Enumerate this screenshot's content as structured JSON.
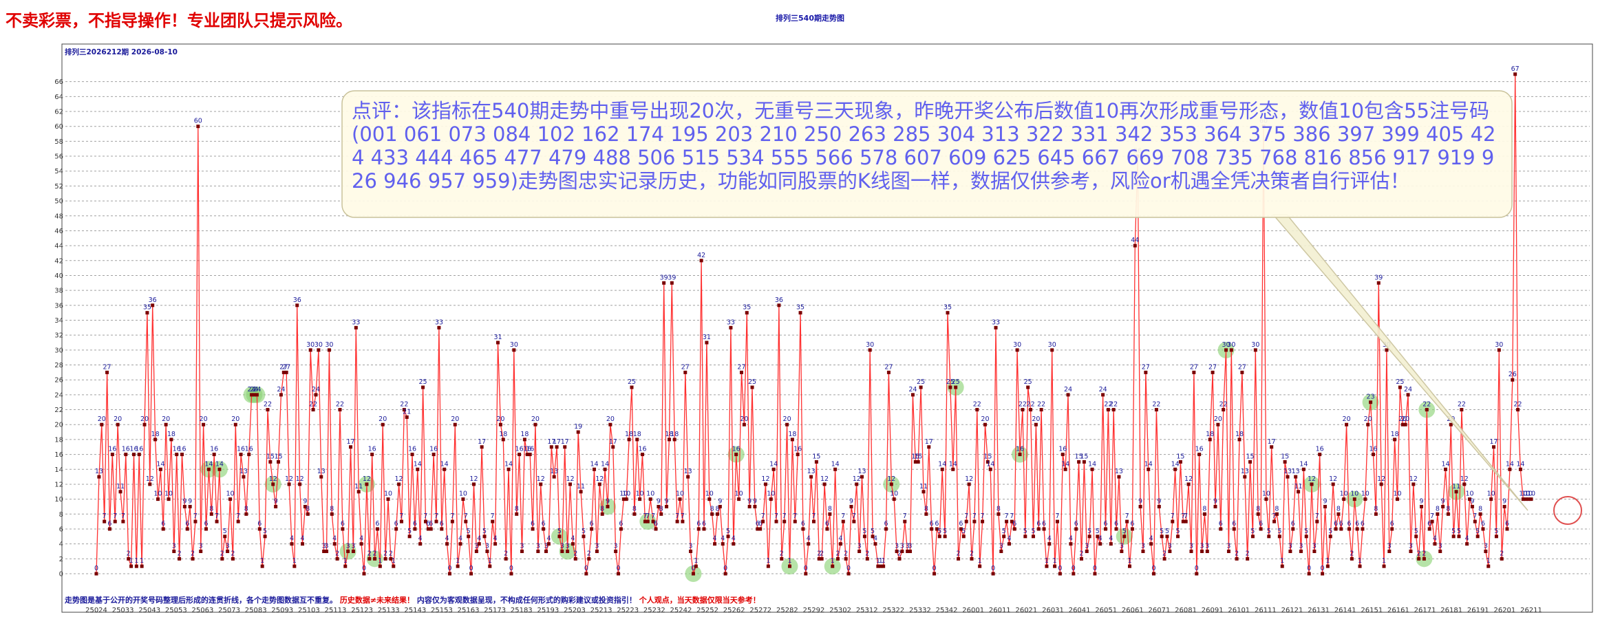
{
  "page": {
    "warning": "不卖彩票，不指导操作！专业团队只提示风险。",
    "title": "排列三540期走势图",
    "issue_label": "排列三2026212期  2026-08-10",
    "footer_blue": "走势图是基于公开的开奖号码整理后形成的连贯折线，各个走势图数据互不重复。",
    "footer_red1": "历史数据≠未来结果！",
    "footer_blue2": "内容仅为客观数据呈现，不构成任何形式的购彩建议或投资指引！",
    "footer_red2": "个人观点，当天数据仅限当天参考！",
    "callout": "点评：该指标在540期走势中重号出现20次，无重号三天现象，昨晚开奖公布后数值10再次形成重号形态，数值10包含55注号码(001 061 073 084 102 162 174 195 203 210 250 263 285 304 313 322 331 342 353 364 375 386 397 399 405 424 433 444 465 477 479 488 506 515 534 555 566 578 607 609 625 645 667 669 708 735 768 816 856 917 919 926 946 957 959)走势图忠实记录历史，功能如同股票的K线图一样，数据仅供参考，风险or机遇全凭决策者自行评估！"
  },
  "colors": {
    "line": "#ff3030",
    "point": "#7a0000",
    "label": "#1a1a9a",
    "grid": "#a0a0a0",
    "highlight": "#8fd47a",
    "callout_bg": "#fffbe6",
    "callout_text": "#6060ee",
    "warning": "#e00000"
  },
  "chart_data": {
    "type": "line",
    "title": "排列三540期走势图",
    "xlabel": "",
    "ylabel": "",
    "ylim": [
      0,
      68
    ],
    "yticks": [
      0,
      2,
      4,
      6,
      8,
      10,
      12,
      14,
      16,
      18,
      20,
      22,
      24,
      26,
      28,
      30,
      32,
      34,
      36,
      38,
      40,
      42,
      44,
      46,
      48,
      50,
      52,
      54,
      56,
      58,
      60,
      62,
      64,
      66
    ],
    "grid": true,
    "x_tick_labels": [
      "25024",
      "25033",
      "25043",
      "25053",
      "25063",
      "25073",
      "25083",
      "25093",
      "25103",
      "25113",
      "25123",
      "25133",
      "25143",
      "25153",
      "25163",
      "25173",
      "25183",
      "25193",
      "25203",
      "25213",
      "25223",
      "25232",
      "25242",
      "25252",
      "25262",
      "25272",
      "25282",
      "25292",
      "25302",
      "25312",
      "25322",
      "25332",
      "25342",
      "26001",
      "26011",
      "26021",
      "26031",
      "26041",
      "26051",
      "26061",
      "26071",
      "26081",
      "26091",
      "26101",
      "26111",
      "26121",
      "26131",
      "26141",
      "26151",
      "26161",
      "26171",
      "26181",
      "26191",
      "26201",
      "26211"
    ],
    "series": [
      {
        "values": [
          0,
          13,
          20,
          7,
          27,
          6,
          16,
          7,
          20,
          11,
          7,
          16,
          2,
          1,
          16,
          1,
          16,
          1,
          20,
          35,
          12,
          36,
          18,
          10,
          14,
          6,
          20,
          10,
          18,
          3,
          16,
          2,
          16,
          9,
          6,
          9,
          2,
          7,
          60,
          3,
          20,
          6,
          14,
          8,
          16,
          7,
          14,
          2,
          5,
          3,
          10,
          2,
          20,
          7,
          16,
          13,
          8,
          16,
          24,
          24,
          24,
          6,
          1,
          5,
          22,
          15,
          12,
          9,
          15,
          24,
          27,
          27,
          12,
          4,
          1,
          36,
          12,
          4,
          9,
          8,
          30,
          22,
          24,
          30,
          13,
          3,
          3,
          30,
          8,
          4,
          2,
          22,
          6,
          1,
          3,
          17,
          3,
          33,
          11,
          4,
          0,
          12,
          2,
          16,
          2,
          6,
          1,
          20,
          2,
          10,
          2,
          1,
          6,
          12,
          7,
          22,
          21,
          5,
          16,
          6,
          14,
          4,
          25,
          7,
          6,
          6,
          16,
          7,
          33,
          6,
          14,
          4,
          0,
          7,
          20,
          1,
          4,
          10,
          7,
          5,
          0,
          12,
          3,
          4,
          17,
          5,
          3,
          1,
          7,
          4,
          31,
          20,
          18,
          2,
          14,
          0,
          30,
          8,
          16,
          3,
          18,
          16,
          16,
          6,
          20,
          3,
          12,
          6,
          3,
          4,
          17,
          13,
          17,
          5,
          3,
          17,
          3,
          12,
          4,
          2,
          19,
          11,
          5,
          0,
          2,
          6,
          14,
          3,
          12,
          8,
          14,
          9,
          20,
          17,
          3,
          0,
          6,
          10,
          10,
          18,
          25,
          8,
          18,
          10,
          16,
          7,
          7,
          10,
          7,
          6,
          9,
          8,
          39,
          9,
          18,
          39,
          18,
          7,
          10,
          7,
          27,
          13,
          3,
          0,
          1,
          6,
          42,
          6,
          31,
          10,
          8,
          4,
          8,
          9,
          4,
          0,
          5,
          33,
          4,
          16,
          10,
          27,
          20,
          35,
          9,
          25,
          9,
          6,
          6,
          7,
          12,
          1,
          10,
          14,
          7,
          36,
          2,
          7,
          20,
          1,
          18,
          7,
          16,
          35,
          6,
          0,
          4,
          13,
          7,
          15,
          2,
          2,
          12,
          6,
          8,
          1,
          14,
          2,
          4,
          7,
          2,
          0,
          9,
          7,
          12,
          3,
          13,
          5,
          2,
          30,
          5,
          4,
          1,
          1,
          1,
          6,
          27,
          12,
          10,
          3,
          2,
          3,
          7,
          3,
          3,
          24,
          15,
          15,
          25,
          11,
          8,
          17,
          6,
          0,
          6,
          5,
          14,
          5,
          35,
          25,
          14,
          25,
          2,
          6,
          5,
          7,
          12,
          2,
          7,
          22,
          1,
          7,
          20,
          15,
          14,
          0,
          33,
          8,
          3,
          5,
          7,
          4,
          7,
          6,
          30,
          16,
          22,
          5,
          25,
          22,
          5,
          20,
          6,
          22,
          6,
          1,
          4,
          30,
          1,
          7,
          0,
          16,
          14,
          24,
          4,
          0,
          6,
          15,
          2,
          15,
          3,
          5,
          14,
          0,
          5,
          4,
          24,
          6,
          22,
          4,
          22,
          6,
          13,
          3,
          5,
          7,
          1,
          6,
          44,
          56,
          9,
          3,
          27,
          14,
          4,
          0,
          22,
          9,
          5,
          2,
          5,
          3,
          7,
          14,
          5,
          15,
          7,
          7,
          12,
          3,
          27,
          0,
          16,
          3,
          8,
          3,
          18,
          27,
          9,
          20,
          6,
          22,
          30,
          3,
          30,
          6,
          2,
          18,
          27,
          13,
          2,
          15,
          5,
          30,
          8,
          6,
          60,
          10,
          5,
          17,
          7,
          8,
          5,
          1,
          15,
          13,
          3,
          6,
          13,
          11,
          3,
          14,
          5,
          0,
          12,
          3,
          7,
          16,
          0,
          9,
          1,
          5,
          12,
          6,
          8,
          6,
          10,
          20,
          6,
          2,
          10,
          6,
          1,
          6,
          10,
          20,
          23,
          16,
          8,
          39,
          12,
          1,
          30,
          3,
          6,
          18,
          10,
          25,
          20,
          20,
          24,
          3,
          12,
          5,
          2,
          9,
          2,
          22,
          6,
          7,
          4,
          8,
          3,
          9,
          14,
          8,
          20,
          5,
          11,
          5,
          22,
          12,
          4,
          10,
          9,
          7,
          5,
          8,
          6,
          3,
          1,
          10,
          17,
          5,
          30,
          2,
          9,
          6,
          14,
          26,
          67,
          22,
          14,
          10,
          10,
          10,
          10
        ],
        "value_labels": [
          "0",
          "13",
          "20",
          "7",
          "27",
          "6",
          "16",
          "7",
          "20",
          "11",
          "7",
          "16",
          "2",
          "1",
          "16",
          "1",
          "16",
          "1",
          "20",
          "35",
          "12",
          "36",
          "18",
          "10",
          "14",
          "6",
          "20",
          "10",
          "18",
          "3",
          "16",
          "2",
          "16",
          "9",
          "6",
          "9",
          "2",
          "7",
          "60",
          "3",
          "20",
          "6",
          "14",
          "8",
          "16",
          "7",
          "14",
          "2",
          "5",
          "3",
          "10",
          "2",
          "20",
          "7",
          "16",
          "13",
          "8",
          "16",
          "24",
          "24",
          "24",
          "6",
          "1",
          "5",
          "22",
          "15",
          "12",
          "9",
          "15",
          "24",
          "27",
          "27",
          "12",
          "4",
          "1",
          "36",
          "12",
          "4",
          "9",
          "8",
          "30",
          "22",
          "24",
          "30",
          "13",
          "3",
          "3",
          "30",
          "8",
          "4",
          "2",
          "22",
          "6",
          "1",
          "3",
          "17",
          "3",
          "33",
          "11",
          "4",
          "0",
          "12",
          "2",
          "16",
          "2",
          "6",
          "1",
          "20",
          "2",
          "10",
          "2",
          "1",
          "6",
          "12",
          "7",
          "22",
          "21",
          "5",
          "16",
          "6",
          "14",
          "4",
          "25",
          "7",
          "6",
          "6",
          "16",
          "7",
          "33",
          "6",
          "14",
          "4",
          "0",
          "7",
          "20",
          "1",
          "4",
          "10",
          "7",
          "5",
          "0",
          "12",
          "3",
          "4",
          "17",
          "5",
          "3",
          "1",
          "7",
          "4",
          "31",
          "20",
          "18",
          "2",
          "14",
          "0",
          "30",
          "8",
          "16",
          "3",
          "18",
          "16",
          "16",
          "6",
          "20",
          "3",
          "12",
          "6",
          "3",
          "4",
          "17",
          "13",
          "17",
          "5",
          "3",
          "17",
          "3",
          "12",
          "4",
          "2",
          "19",
          "11",
          "5",
          "0",
          "2",
          "6",
          "14",
          "3",
          "12",
          "8",
          "14",
          "9",
          "20",
          "17",
          "3",
          "0",
          "6",
          "10",
          "10",
          "18",
          "25",
          "8",
          "18",
          "10",
          "16",
          "7",
          "7",
          "10",
          "7",
          "6",
          "9",
          "8",
          "39",
          "9",
          "18",
          "39",
          "18",
          "7",
          "10",
          "7",
          "27",
          "13",
          "3",
          "0",
          "1",
          "6",
          "42",
          "6",
          "31",
          "10",
          "8",
          "4",
          "8",
          "9",
          "4",
          "0",
          "5",
          "33",
          "4",
          "16",
          "10",
          "27",
          "20",
          "35",
          "9",
          "25",
          "9",
          "6",
          "6",
          "7",
          "12",
          "1",
          "10",
          "14",
          "7",
          "36",
          "2",
          "7",
          "20",
          "1",
          "18",
          "7",
          "16",
          "35",
          "6",
          "0",
          "4",
          "13",
          "7",
          "15",
          "2",
          "2",
          "12",
          "6",
          "8",
          "1",
          "14",
          "2",
          "4",
          "7",
          "2",
          "0",
          "9",
          "7",
          "12",
          "3",
          "13",
          "5",
          "2",
          "30",
          "5",
          "4",
          "1",
          "1",
          "1",
          "6",
          "27",
          "12",
          "10",
          "3",
          "2",
          "3",
          "7",
          "3",
          "3",
          "24",
          "15",
          "15",
          "25",
          "11",
          "8",
          "17",
          "6",
          "0",
          "6",
          "5",
          "14",
          "5",
          "35",
          "25",
          "14",
          "25",
          "2",
          "6",
          "5",
          "7",
          "12",
          "2",
          "7",
          "22",
          "1",
          "7",
          "20",
          "15",
          "14",
          "0",
          "33",
          "8",
          "3",
          "5",
          "7",
          "4",
          "7",
          "6",
          "30",
          "16",
          "22",
          "5",
          "25",
          "22",
          "5",
          "20",
          "6",
          "22",
          "6",
          "1",
          "4",
          "30",
          "1",
          "7",
          "0",
          "16",
          "14",
          "24",
          "4",
          "0",
          "6",
          "15",
          "2",
          "15",
          "3",
          "5",
          "14",
          "0",
          "5",
          "4",
          "24",
          "6",
          "22",
          "4",
          "22",
          "6",
          "13",
          "3",
          "5",
          "7",
          "1",
          "6",
          "44",
          "56",
          "9",
          "3",
          "27",
          "14",
          "4",
          "0",
          "22",
          "9",
          "5",
          "2",
          "5",
          "3",
          "7",
          "14",
          "5",
          "15",
          "7",
          "7",
          "12",
          "3",
          "27",
          "0",
          "16",
          "3",
          "8",
          "3",
          "18",
          "27",
          "9",
          "20",
          "6",
          "22",
          "30",
          "3",
          "30",
          "6",
          "2",
          "18",
          "27",
          "13",
          "2",
          "15",
          "5",
          "30",
          "8",
          "6",
          "60",
          "10",
          "5",
          "17",
          "7",
          "8",
          "5",
          "1",
          "15",
          "13",
          "3",
          "6",
          "13",
          "11",
          "3",
          "14",
          "5",
          "0",
          "12",
          "3",
          "7",
          "16",
          "0",
          "9",
          "1",
          "5",
          "12",
          "6",
          "8",
          "6",
          "10",
          "20",
          "6",
          "2",
          "10",
          "6",
          "1",
          "6",
          "10",
          "20",
          "23",
          "16",
          "8",
          "39",
          "12",
          "1",
          "30",
          "3",
          "6",
          "18",
          "10",
          "25",
          "20",
          "20",
          "24",
          "3",
          "12",
          "5",
          "2",
          "9",
          "2",
          "22",
          "6",
          "7",
          "4",
          "8",
          "3",
          "9",
          "14",
          "8",
          "20",
          "5",
          "11",
          "5",
          "22",
          "12",
          "4",
          "10",
          "9",
          "7",
          "5",
          "8",
          "6",
          "3",
          "1",
          "10",
          "17",
          "5",
          "30",
          "2",
          "9",
          "6",
          "14",
          "26",
          "67",
          "22",
          "14",
          "10",
          "10",
          "10",
          "10"
        ],
        "highlight_indices": [
          58,
          59,
          60,
          42,
          46,
          66,
          94,
          101,
          104,
          173,
          176,
          191,
          206,
          223,
          239,
          259,
          275,
          297,
          321,
          345,
          384,
          422,
          454,
          470,
          476,
          496,
          497,
          508
        ]
      }
    ]
  }
}
